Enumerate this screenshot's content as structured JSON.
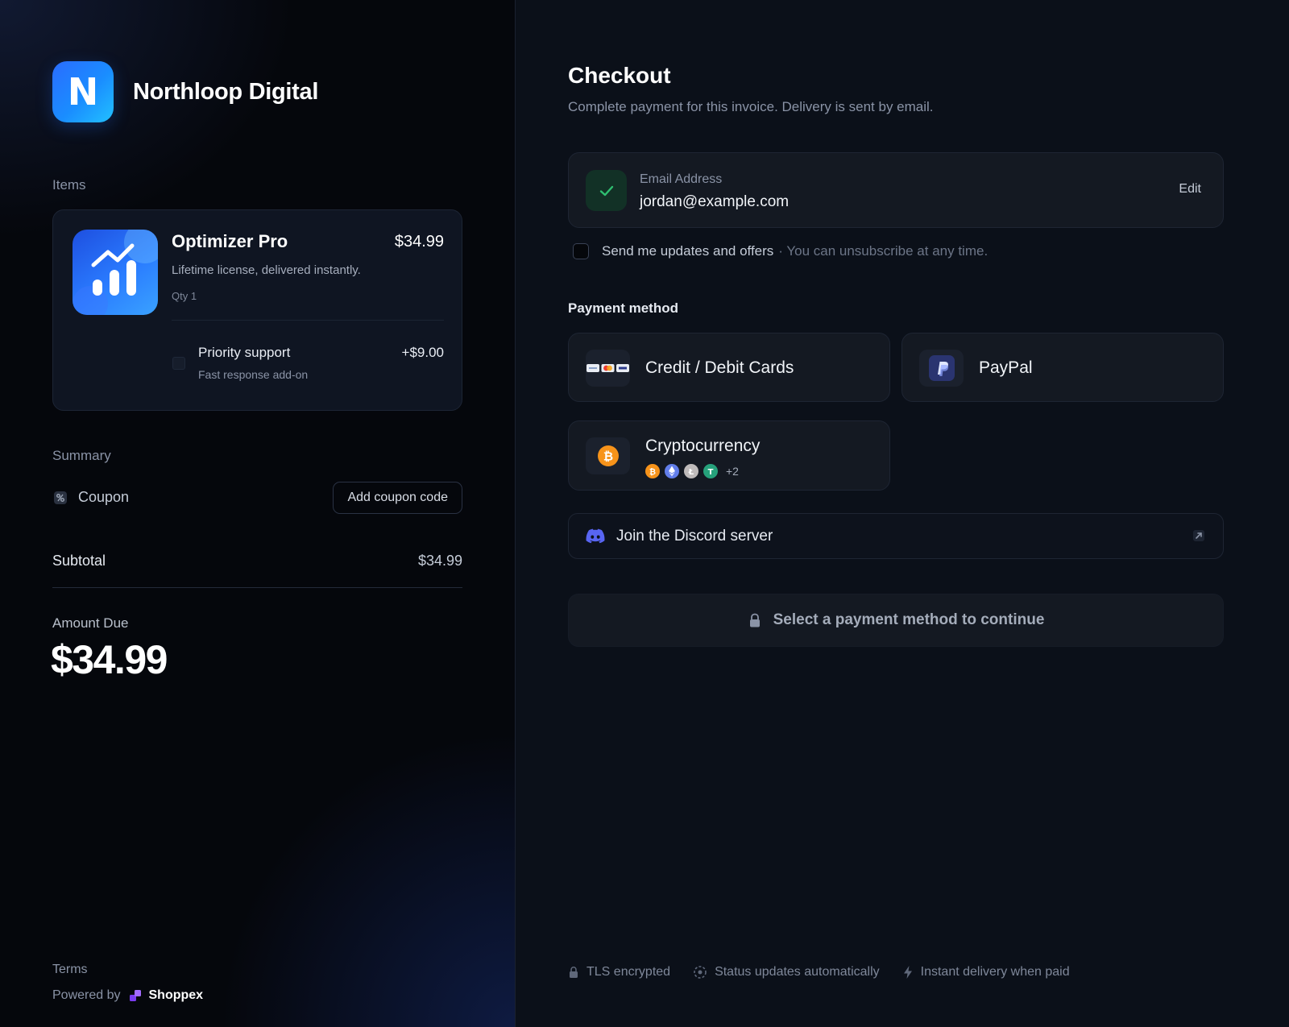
{
  "brand": {
    "logo_letter": "N",
    "name": "Northloop Digital",
    "accent": "#2a7cff"
  },
  "items": {
    "label": "Items",
    "product": {
      "name": "Optimizer Pro",
      "price": "$34.99",
      "description": "Lifetime license, delivered instantly.",
      "qty": "Qty 1"
    },
    "addon": {
      "name": "Priority support",
      "price": "+$9.00",
      "description": "Fast response add-on"
    }
  },
  "summary": {
    "label": "Summary",
    "coupon_label": "Coupon",
    "coupon_button": "Add coupon code",
    "subtotal_label": "Subtotal",
    "subtotal_value": "$34.99",
    "amount_due_label": "Amount Due",
    "amount_due_value": "$34.99"
  },
  "footer_left": {
    "terms": "Terms",
    "powered_by": "Powered by",
    "provider": "Shoppex"
  },
  "checkout": {
    "title": "Checkout",
    "subtitle": "Complete payment for this invoice. Delivery is sent by email.",
    "email": {
      "label": "Email Address",
      "value": "jordan@example.com",
      "edit": "Edit",
      "status_color": "#2fbf71"
    },
    "updates": {
      "label": "Send me updates and offers",
      "note": "· You can unsubscribe at any time."
    },
    "payment_method_label": "Payment method",
    "methods": [
      {
        "title": "Credit / Debit Cards",
        "icon": "credit-cards-icon"
      },
      {
        "title": "PayPal",
        "icon": "paypal-icon"
      },
      {
        "title": "Cryptocurrency",
        "icon": "bitcoin-icon",
        "more": "+2"
      }
    ],
    "discord": {
      "label": "Join the Discord server",
      "color": "#5865f2"
    },
    "continue_button": "Select a payment method to continue"
  },
  "footer_right": {
    "tls": "TLS encrypted",
    "status": "Status updates automatically",
    "delivery": "Instant delivery when paid"
  }
}
